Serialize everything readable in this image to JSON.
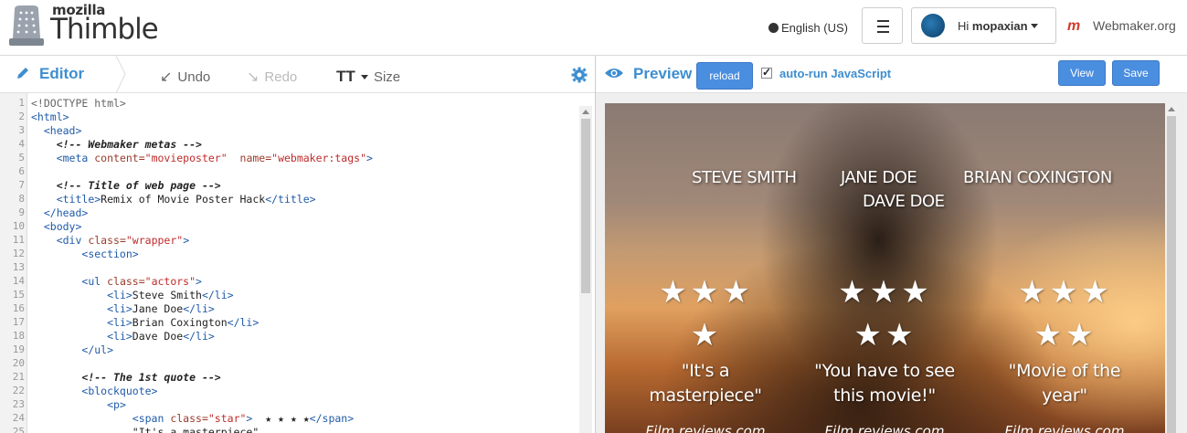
{
  "header": {
    "logo_small": "mozilla",
    "logo_big": "Thimble",
    "language": "English (US)",
    "user_greeting": "Hi",
    "username": "mopaxian",
    "webmaker_link": "Webmaker.org"
  },
  "editor_toolbar": {
    "title": "Editor",
    "undo": "Undo",
    "redo": "Redo",
    "size_glyph": "TT",
    "size": "Size"
  },
  "preview_toolbar": {
    "title": "Preview",
    "reload": "reload",
    "auto_run": "auto-run JavaScript",
    "auto_run_checked": true,
    "view": "View",
    "save": "Save"
  },
  "code": {
    "line_numbers": [
      "1",
      "2",
      "3",
      "4",
      "5",
      "6",
      "7",
      "8",
      "9",
      "10",
      "11",
      "12",
      "13",
      "14",
      "15",
      "16",
      "17",
      "18",
      "19",
      "20",
      "21",
      "22",
      "23",
      "24",
      "25"
    ],
    "lines": [
      [
        [
          "doc",
          "<!DOCTYPE html>"
        ]
      ],
      [
        [
          "tag",
          "<html>"
        ]
      ],
      [
        [
          "",
          "  "
        ],
        [
          "tag",
          "<head>"
        ]
      ],
      [
        [
          "",
          "    "
        ],
        [
          "com",
          "<!-- Webmaker metas -->"
        ]
      ],
      [
        [
          "",
          "    "
        ],
        [
          "tag",
          "<meta "
        ],
        [
          "attr",
          "content="
        ],
        [
          "str",
          "\"movieposter\""
        ],
        [
          "",
          "  "
        ],
        [
          "attr",
          "name="
        ],
        [
          "str",
          "\"webmaker:tags\""
        ],
        [
          "tag",
          ">"
        ]
      ],
      [],
      [
        [
          "",
          "    "
        ],
        [
          "com",
          "<!-- Title of web page -->"
        ]
      ],
      [
        [
          "",
          "    "
        ],
        [
          "tag",
          "<title>"
        ],
        [
          "",
          "Remix of Movie Poster Hack"
        ],
        [
          "tag",
          "</title>"
        ]
      ],
      [
        [
          "",
          "  "
        ],
        [
          "tag",
          "</head>"
        ]
      ],
      [
        [
          "",
          "  "
        ],
        [
          "tag",
          "<body>"
        ]
      ],
      [
        [
          "",
          "    "
        ],
        [
          "tag",
          "<div "
        ],
        [
          "attr",
          "class="
        ],
        [
          "str",
          "\"wrapper\""
        ],
        [
          "tag",
          ">"
        ]
      ],
      [
        [
          "",
          "        "
        ],
        [
          "tag",
          "<section>"
        ]
      ],
      [],
      [
        [
          "",
          "        "
        ],
        [
          "tag",
          "<ul "
        ],
        [
          "attr",
          "class="
        ],
        [
          "str",
          "\"actors\""
        ],
        [
          "tag",
          ">"
        ]
      ],
      [
        [
          "",
          "            "
        ],
        [
          "tag",
          "<li>"
        ],
        [
          "",
          "Steve Smith"
        ],
        [
          "tag",
          "</li>"
        ]
      ],
      [
        [
          "",
          "            "
        ],
        [
          "tag",
          "<li>"
        ],
        [
          "",
          "Jane Doe"
        ],
        [
          "tag",
          "</li>"
        ]
      ],
      [
        [
          "",
          "            "
        ],
        [
          "tag",
          "<li>"
        ],
        [
          "",
          "Brian Coxington"
        ],
        [
          "tag",
          "</li>"
        ]
      ],
      [
        [
          "",
          "            "
        ],
        [
          "tag",
          "<li>"
        ],
        [
          "",
          "Dave Doe"
        ],
        [
          "tag",
          "</li>"
        ]
      ],
      [
        [
          "",
          "        "
        ],
        [
          "tag",
          "</ul>"
        ]
      ],
      [],
      [
        [
          "",
          "        "
        ],
        [
          "com",
          "<!-- The 1st quote -->"
        ]
      ],
      [
        [
          "",
          "        "
        ],
        [
          "tag",
          "<blockquote>"
        ]
      ],
      [
        [
          "",
          "            "
        ],
        [
          "tag",
          "<p>"
        ]
      ],
      [
        [
          "",
          "                "
        ],
        [
          "tag",
          "<span "
        ],
        [
          "attr",
          "class="
        ],
        [
          "str",
          "\"star\""
        ],
        [
          "tag",
          ">"
        ],
        [
          "",
          "  ★ ★ ★ ★"
        ],
        [
          "tag",
          "</span>"
        ]
      ],
      [
        [
          "",
          "                "
        ],
        [
          "",
          "\"It's a masterpiece\""
        ]
      ]
    ]
  },
  "poster": {
    "actors": [
      "STEVE SMITH",
      "JANE DOE",
      "BRIAN COXINGTON",
      "DAVE DOE"
    ],
    "reviews": [
      {
        "stars_row1": "★★★",
        "stars_row2": "★",
        "quote_line1": "\"It's a",
        "quote_line2": "masterpiece\"",
        "source": "Film reviews.com"
      },
      {
        "stars_row1": "★★★",
        "stars_row2": "★★",
        "quote_line1": "\"You have to see",
        "quote_line2": "this movie!\"",
        "source": "Film reviews.com"
      },
      {
        "stars_row1": "★★★",
        "stars_row2": "★★",
        "quote_line1": "\"Movie of the",
        "quote_line2": "year\"",
        "source": "Film reviews.com"
      }
    ]
  },
  "colors": {
    "accent": "#3e8ed0",
    "button_blue": "#4a8ee0",
    "brand_red": "#d03b2e"
  },
  "icons": {
    "globe": "globe-icon",
    "menu": "hamburger-menu-icon",
    "pencil": "pencil-icon",
    "undo": "undo-arrow-icon",
    "redo": "redo-arrow-icon",
    "gear": "gear-icon",
    "eye": "eye-icon"
  }
}
